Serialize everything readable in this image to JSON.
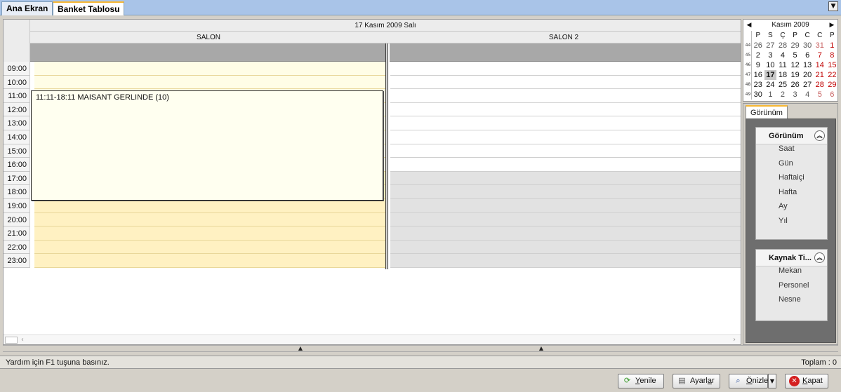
{
  "tabs": [
    {
      "label": "Ana Ekran",
      "active": false
    },
    {
      "label": "Banket Tablosu",
      "active": true
    }
  ],
  "tab_menu_icon": "chevron-down-icon",
  "scheduler": {
    "date": "17 Kasım 2009 Salı",
    "resources": [
      "SALON",
      "SALON 2"
    ],
    "times": [
      "09:00",
      "10:00",
      "11:00",
      "12:00",
      "13:00",
      "14:00",
      "15:00",
      "16:00",
      "17:00",
      "18:00",
      "19:00",
      "20:00",
      "21:00",
      "22:00",
      "23:00"
    ],
    "appointment": {
      "text": "11:11-18:11 MAISANT GERLINDE (10)"
    }
  },
  "calendar": {
    "title": "Kasım 2009",
    "prev_icon": "triangle-left-icon",
    "next_icon": "triangle-right-icon",
    "weekday_names": [
      "P",
      "S",
      "Ç",
      "P",
      "C",
      "C",
      "P"
    ],
    "weeks": [
      {
        "wk": "44",
        "days": [
          {
            "d": "26",
            "muted": true
          },
          {
            "d": "27",
            "muted": true
          },
          {
            "d": "28",
            "muted": true
          },
          {
            "d": "29",
            "muted": true
          },
          {
            "d": "30",
            "muted": true
          },
          {
            "d": "31",
            "muted": true,
            "red": true
          },
          {
            "d": "1",
            "red": true
          }
        ]
      },
      {
        "wk": "45",
        "days": [
          {
            "d": "2"
          },
          {
            "d": "3"
          },
          {
            "d": "4"
          },
          {
            "d": "5"
          },
          {
            "d": "6"
          },
          {
            "d": "7",
            "red": true
          },
          {
            "d": "8",
            "red": true
          }
        ]
      },
      {
        "wk": "46",
        "days": [
          {
            "d": "9"
          },
          {
            "d": "10"
          },
          {
            "d": "11"
          },
          {
            "d": "12"
          },
          {
            "d": "13"
          },
          {
            "d": "14",
            "red": true
          },
          {
            "d": "15",
            "red": true
          }
        ]
      },
      {
        "wk": "47",
        "days": [
          {
            "d": "16"
          },
          {
            "d": "17",
            "today": true
          },
          {
            "d": "18"
          },
          {
            "d": "19"
          },
          {
            "d": "20"
          },
          {
            "d": "21",
            "red": true
          },
          {
            "d": "22",
            "red": true
          }
        ]
      },
      {
        "wk": "48",
        "days": [
          {
            "d": "23"
          },
          {
            "d": "24"
          },
          {
            "d": "25"
          },
          {
            "d": "26"
          },
          {
            "d": "27"
          },
          {
            "d": "28",
            "red": true
          },
          {
            "d": "29",
            "red": true
          }
        ]
      },
      {
        "wk": "49",
        "days": [
          {
            "d": "30"
          },
          {
            "d": "1",
            "muted": true
          },
          {
            "d": "2",
            "muted": true
          },
          {
            "d": "3",
            "muted": true
          },
          {
            "d": "4",
            "muted": true
          },
          {
            "d": "5",
            "muted": true,
            "red": true
          },
          {
            "d": "6",
            "muted": true,
            "red": true
          }
        ]
      }
    ]
  },
  "view_panel": {
    "tab_label": "Görünüm",
    "groups": [
      {
        "title": "Görünüm",
        "items": [
          "Saat",
          "Gün",
          "Haftaiçi",
          "Hafta",
          "Ay",
          "Yıl"
        ]
      },
      {
        "title": "Kaynak Ti...",
        "items": [
          "Mekan",
          "Personel",
          "Nesne"
        ]
      }
    ]
  },
  "status": {
    "help": "Yardım için F1 tuşuna basınız.",
    "total": "Toplam : 0"
  },
  "buttons": {
    "refresh": {
      "pre": "",
      "u": "Y",
      "post": "enile",
      "icon": "refresh-icon"
    },
    "settings": {
      "pre": "Ayarl",
      "u": "a",
      "post": "r",
      "icon": "settings-document-icon"
    },
    "preview": {
      "pre": "",
      "u": "Ö",
      "post": "nizle",
      "icon": "print-preview-icon"
    },
    "close": {
      "pre": "",
      "u": "K",
      "post": "apat",
      "icon": "close-icon"
    }
  },
  "colors": {
    "tab_accent": "#f7b733",
    "salon_work": "#fffde6",
    "salon_off": "#fff1c2",
    "salon2_off": "#e2e2e2",
    "weekend": "#c00000"
  }
}
